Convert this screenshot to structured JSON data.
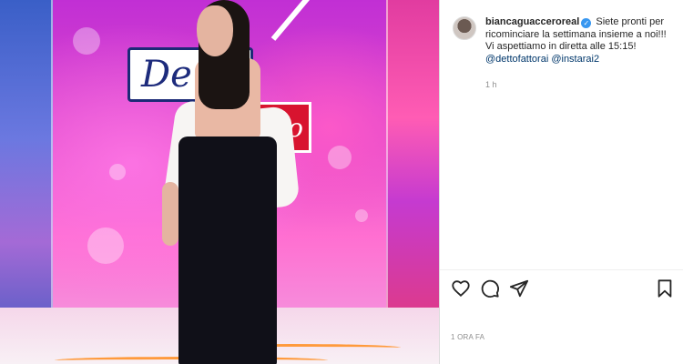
{
  "post": {
    "username": "biancaguacceroreal",
    "verified_icon": "verified-badge-icon",
    "caption_text": "Siete pronti per ricominciare la settimana insieme a noi!!! Vi aspettiamo in diretta alle 15:15!",
    "mention_1": "@dettofattorai",
    "mention_2": "@instarai2",
    "comment_time": "1 h",
    "posted_time": "1 ORA FA"
  },
  "photo": {
    "logo_text_1": "De",
    "logo_text_2": "to"
  },
  "actions": {
    "like_icon": "heart-icon",
    "comment_icon": "comment-icon",
    "share_icon": "paper-plane-icon",
    "save_icon": "bookmark-icon"
  },
  "colors": {
    "mention": "#00376b",
    "verified": "#3897f0",
    "muted_text": "#8e8e8e"
  }
}
